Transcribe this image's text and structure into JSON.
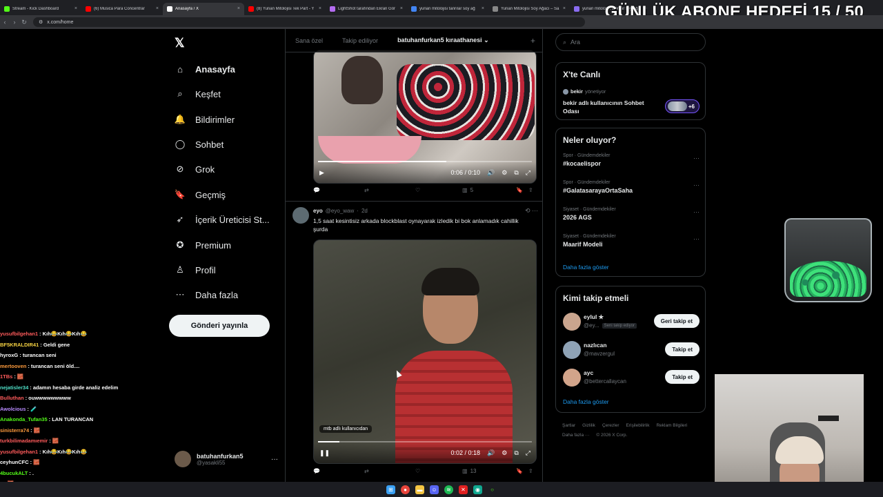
{
  "browser": {
    "tabs": [
      {
        "title": "Stream - Kick Dashboard",
        "icon": "kick-icon",
        "color": "#53fc18"
      },
      {
        "title": "(6) Musica Para Concentrar",
        "icon": "youtube-icon",
        "color": "#ff0000"
      },
      {
        "title": "Anasayfa / X",
        "icon": "x-icon",
        "color": "#ffffff",
        "active": true
      },
      {
        "title": "(8) Yunan Mitolojisi Tek Part - Y",
        "icon": "youtube-icon",
        "color": "#ff0000"
      },
      {
        "title": "LightShot tarafından Ekran Gör",
        "icon": "lightshot-icon",
        "color": "#b46cf0"
      },
      {
        "title": "yunan mitolojisi tanrılar soy ağ",
        "icon": "google-icon",
        "color": "#4285f4"
      },
      {
        "title": "Yunan Mitolojisi Soy Ağacı – Sa",
        "icon": "web-icon",
        "color": "#888888"
      },
      {
        "title": "yunan mitolojisi tanrılar soy ağ",
        "icon": "web-icon",
        "color": "#8a6cf0"
      }
    ],
    "url": "x.com/home"
  },
  "overlay": {
    "goal_text": "GÜNLÜK ABONE HEDEFİ 15 / 50",
    "goal_current": 15,
    "goal_target": 50
  },
  "nav": {
    "items": [
      {
        "label": "Anasayfa",
        "icon": "home-icon",
        "bold": true
      },
      {
        "label": "Keşfet",
        "icon": "search-icon"
      },
      {
        "label": "Bildirimler",
        "icon": "bell-icon"
      },
      {
        "label": "Sohbet",
        "icon": "chat-icon"
      },
      {
        "label": "Grok",
        "icon": "grok-icon"
      },
      {
        "label": "Geçmiş",
        "icon": "bookmark-icon"
      },
      {
        "label": "İçerik Üreticisi St...",
        "icon": "rocket-icon"
      },
      {
        "label": "Premium",
        "icon": "premium-icon"
      },
      {
        "label": "Profil",
        "icon": "profile-icon"
      },
      {
        "label": "Daha fazla",
        "icon": "more-icon"
      }
    ],
    "post_button": "Gönderi yayınla",
    "account": {
      "name": "batuhanfurkan5",
      "handle": "@yasakli55"
    }
  },
  "feed": {
    "tabs": [
      "Sana özel",
      "Takip ediliyor",
      "batuhanfurkan5 kıraathanesi"
    ],
    "video1": {
      "time": "0:06 / 0:10",
      "progress": 0.6
    },
    "video1_actions": {
      "views": "5"
    },
    "tweet2": {
      "name": "eyo",
      "handle": "@eyo_waw",
      "time": "2d",
      "text": "1,5 saat kesintisiz arkada blockblast oynayarak izledik bi bok anlamadık cahillik şurda"
    },
    "video2": {
      "time": "0:02 / 0:18",
      "progress": 0.1,
      "tag": "mtb adlı kullanıcıdan"
    },
    "video2_actions": {
      "views": "13"
    }
  },
  "right": {
    "search_placeholder": "Ara",
    "live": {
      "title": "X'te Canlı",
      "host": "bekir",
      "host_suffix": "yönetiyor",
      "room": "bekir adlı kullanıcının Sohbet Odası",
      "count": "+6"
    },
    "trends": {
      "title": "Neler oluyor?",
      "items": [
        {
          "category": "Spor · Gündemdekiler",
          "name": "#kocaelispor"
        },
        {
          "category": "Spor · Gündemdekiler",
          "name": "#GalatasarayaOrtaSaha"
        },
        {
          "category": "Siyaset · Gündemdekiler",
          "name": "2026 AGS"
        },
        {
          "category": "Siyaset · Gündemdekiler",
          "name": "Maarif Modeli"
        }
      ],
      "show_more": "Daha fazla göster"
    },
    "follow": {
      "title": "Kimi takip etmeli",
      "items": [
        {
          "name": "eylul ✮",
          "handle": "@ey...",
          "badge": "Seni takip ediyor",
          "button": "Geri takip et"
        },
        {
          "name": "nazlıcan",
          "handle": "@mavzergul",
          "button": "Takip et"
        },
        {
          "name": "ayc",
          "handle": "@bettercallaycan",
          "button": "Takip et"
        }
      ],
      "show_more": "Daha fazla göster"
    },
    "footer": [
      "Şartlar",
      "Gizlilik",
      "Çerezler",
      "Erişilebilirlik",
      "Reklam Bilgileri",
      "Daha fazla ···",
      "© 2026 X Corp."
    ]
  },
  "chat": [
    {
      "user": "yusufbilgehan1",
      "color": "#ff5b5b",
      "msg": ": Kıh😂Kıh😂Kıh😂"
    },
    {
      "user": "BF5KRALDIR41",
      "color": "#f5d142",
      "msg": ": Geldi gene"
    },
    {
      "user": "hyroxG",
      "color": "#ffffff",
      "msg": ": turancan seni"
    },
    {
      "user": "mertooven",
      "color": "#ff9b3d",
      "msg": ": turancan seni öld...."
    },
    {
      "user": "1TBs",
      "color": "#ff5b5b",
      "msg": ": 🧱"
    },
    {
      "user": "nejatisler34",
      "color": "#4fe0c8",
      "msg": ": adamın hesaba girde analiz edelim"
    },
    {
      "user": "Bulluthan",
      "color": "#ff5b5b",
      "msg": ": ouwwwwwwwww"
    },
    {
      "user": "Awolcious",
      "color": "#b98bff",
      "msg": ": 🧪"
    },
    {
      "user": "Anakonda_Tufan35",
      "color": "#53fc18",
      "msg": ": LAN TURANCAN"
    },
    {
      "user": "sinisterra74",
      "color": "#ff9b3d",
      "msg": ": 🧱"
    },
    {
      "user": "turkbilimadamıemir",
      "color": "#ff5b5b",
      "msg": ": 🧱"
    },
    {
      "user": "yusufbilgehan1",
      "color": "#ff5b5b",
      "msg": ": Kıh😂Kıh😂Kıh😂"
    },
    {
      "user": "ceyhunCFC",
      "color": "#ffffff",
      "msg": ": 🧱"
    },
    {
      "user": "4bucukALT",
      "color": "#53fc18",
      "msg": ": ."
    },
    {
      "user": "s",
      "color": "#ffffff",
      "msg": ": 🧱"
    }
  ],
  "colors": {
    "accent_blue": "#1d9bf0",
    "kick_green": "#53fc18",
    "live_purple": "#7856ff"
  }
}
